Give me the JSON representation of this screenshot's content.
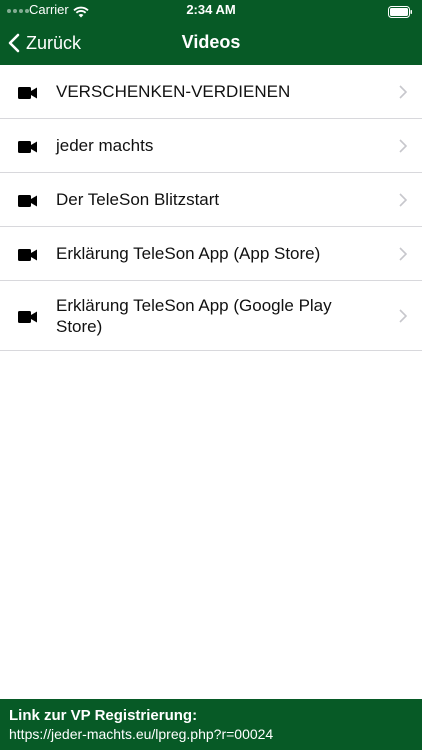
{
  "status_bar": {
    "carrier": "Carrier",
    "time": "2:34 AM"
  },
  "nav": {
    "back_label": "Zurück",
    "title": "Videos"
  },
  "videos": [
    {
      "title": "VERSCHENKEN-VERDIENEN",
      "icon": "video-camera-icon"
    },
    {
      "title": "jeder machts",
      "icon": "video-camera-icon"
    },
    {
      "title": "Der TeleSon Blitzstart",
      "icon": "video-camera-icon"
    },
    {
      "title": "Erklärung TeleSon App (App Store)",
      "icon": "video-camera-icon"
    },
    {
      "title": "Erklärung TeleSon App (Google Play Store)",
      "icon": "video-camera-icon"
    }
  ],
  "footer": {
    "title": "Link zur VP Registrierung:",
    "link": "https://jeder-machts.eu/lpreg.php?r=00024"
  },
  "colors": {
    "brand_green": "#075a26",
    "separator": "#d8d8dc",
    "chevron": "#c7c7cc"
  }
}
